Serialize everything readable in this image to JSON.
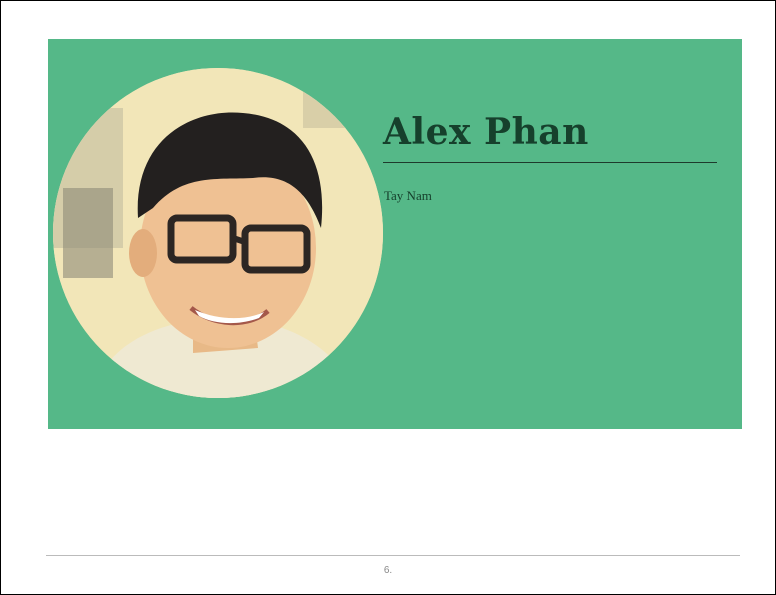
{
  "slide": {
    "name": "Alex Phan",
    "subtitle": "Tay Nam",
    "page_number": "6."
  },
  "colors": {
    "banner": "#55b888",
    "title_text": "#16402c",
    "photo_background": "#f2e6b8"
  },
  "icons": {
    "profile_photo": "person-portrait"
  }
}
